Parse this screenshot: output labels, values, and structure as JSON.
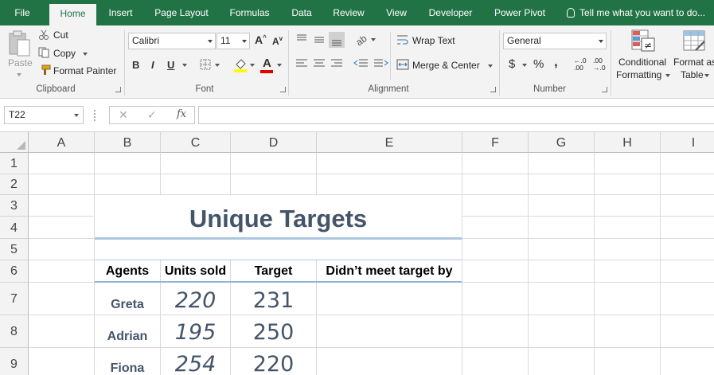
{
  "ribbon_tabs": [
    "File",
    "Home",
    "Insert",
    "Page Layout",
    "Formulas",
    "Data",
    "Review",
    "View",
    "Developer",
    "Power Pivot"
  ],
  "tell_me": "Tell me what you want to do...",
  "clipboard": {
    "paste": "Paste",
    "cut": "Cut",
    "copy": "Copy",
    "format_painter": "Format Painter",
    "label": "Clipboard"
  },
  "font": {
    "name": "Calibri",
    "size": "11",
    "bold": "B",
    "italic": "I",
    "underline": "U",
    "grow": "A",
    "shrink": "A",
    "font_color": "A",
    "label": "Font"
  },
  "alignment": {
    "wrap_text": "Wrap Text",
    "merge_center": "Merge & Center",
    "label": "Alignment"
  },
  "number": {
    "format": "General",
    "currency": "$",
    "percent": "%",
    "comma": ",",
    "inc_decimal": "←.0 .00",
    "dec_decimal": ".00 →.0",
    "label": "Number"
  },
  "styles": {
    "conditional_1": "Conditional",
    "conditional_2": "Formatting",
    "format_as_1": "Format as",
    "format_as_2": "Table"
  },
  "formula_bar": {
    "name_box": "T22",
    "cancel": "✕",
    "enter": "✓",
    "fx": "fx",
    "value": ""
  },
  "columns": [
    "A",
    "B",
    "C",
    "D",
    "E",
    "F",
    "G",
    "H",
    "I"
  ],
  "rows": [
    "1",
    "2",
    "3",
    "4",
    "5",
    "6",
    "7",
    "8",
    "9"
  ],
  "sheet": {
    "title": "Unique Targets",
    "headers": [
      "Agents",
      "Units sold",
      "Target",
      "Didn’t meet target by"
    ],
    "data": [
      {
        "agent": "Greta",
        "units": "220",
        "target": "231"
      },
      {
        "agent": "Adrian",
        "units": "195",
        "target": "250"
      },
      {
        "agent": "Fiona",
        "units": "254",
        "target": "220"
      }
    ]
  },
  "colors": {
    "accent": "#217346",
    "title_text": "#44546a",
    "header_rule": "#8eb4d8"
  }
}
